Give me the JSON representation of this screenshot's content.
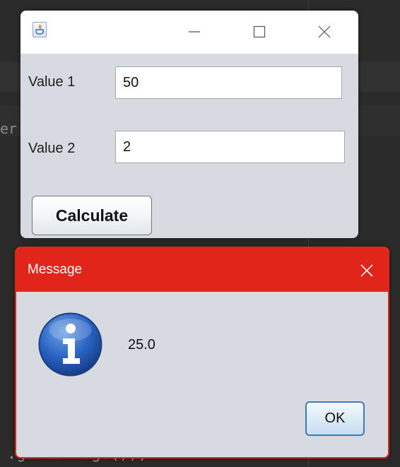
{
  "ide": {
    "code_top": "er",
    "code_bottom": ".getContage());"
  },
  "frame": {
    "title_icon": "java-icon",
    "controls": {
      "minimize_icon": "minimize-icon",
      "maximize_icon": "maximize-icon",
      "close_icon": "close-icon"
    },
    "fields": [
      {
        "label": "Value 1",
        "value": "50"
      },
      {
        "label": "Value 2",
        "value": "2"
      }
    ],
    "calculate_label": "Calculate"
  },
  "dialog": {
    "title": "Message",
    "accent_color": "#e1251b",
    "icon": "info-icon",
    "message": "25.0",
    "ok_label": "OK",
    "close_icon": "close-icon"
  }
}
